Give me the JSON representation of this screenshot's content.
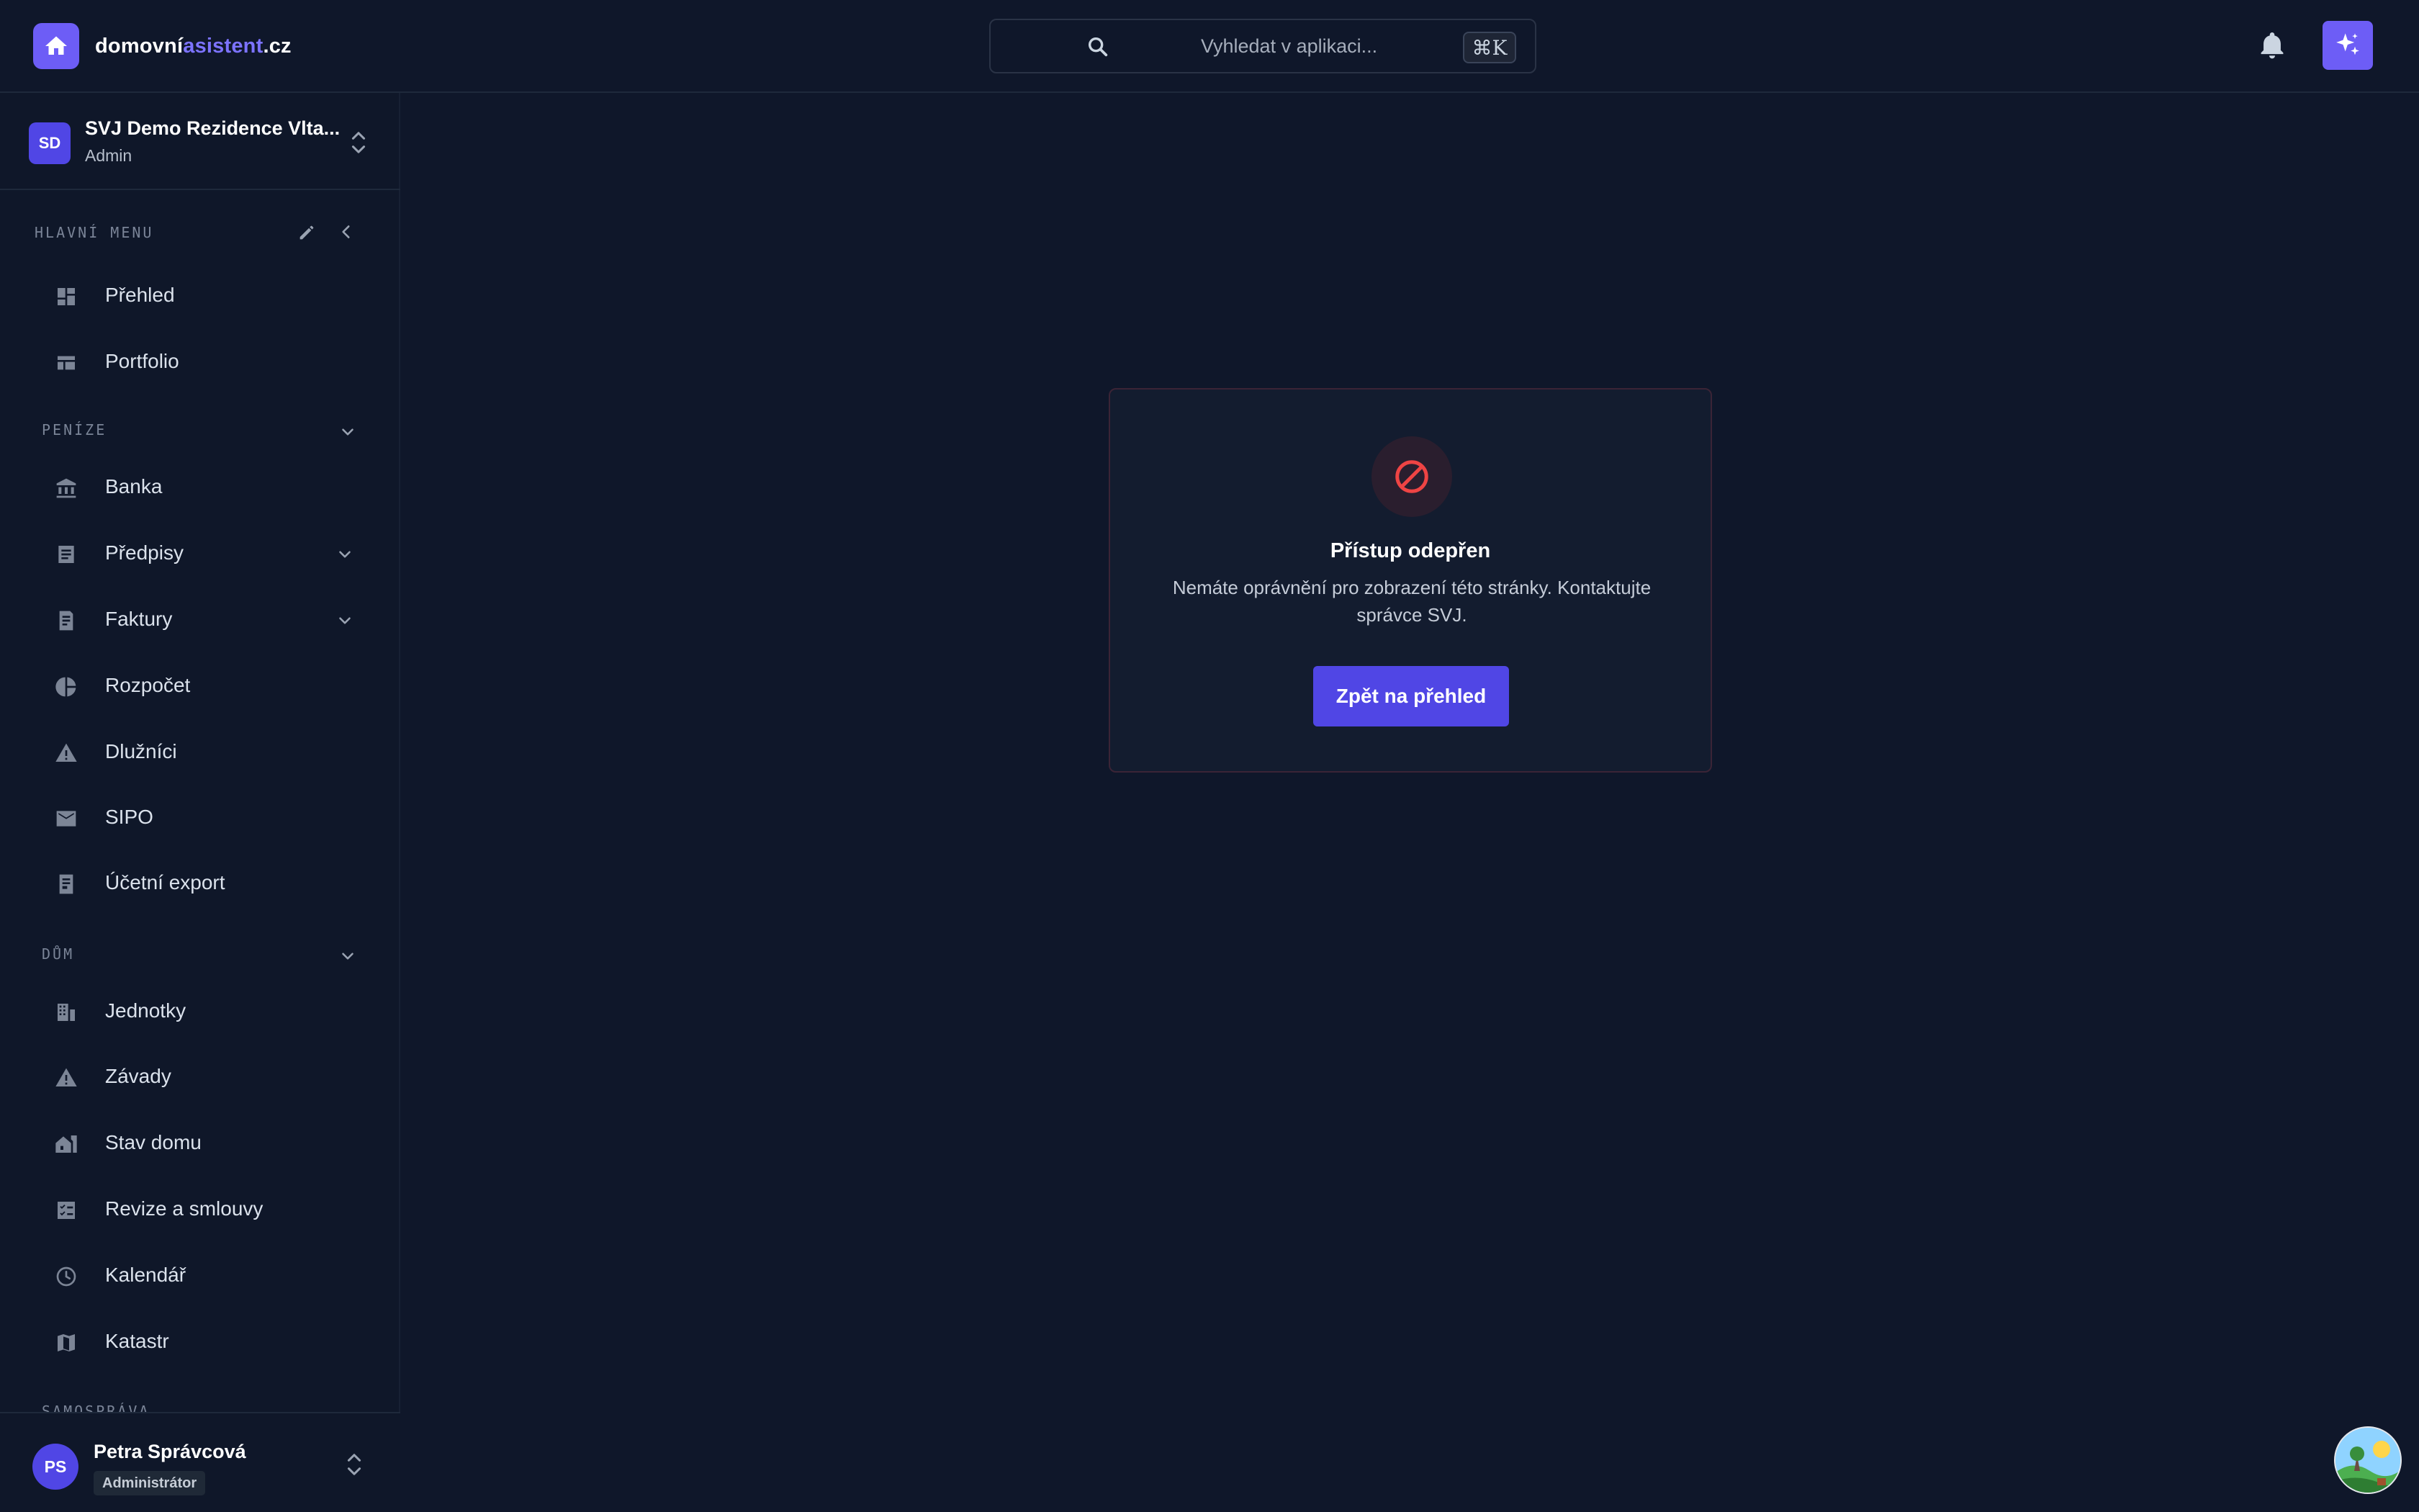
{
  "brand": {
    "name_part1": "domovní",
    "name_part2": "asistent",
    "name_part3": ".cz"
  },
  "search": {
    "placeholder": "Vyhledat v aplikaci...",
    "shortcut": "⌘K"
  },
  "org": {
    "initials": "SD",
    "name": "SVJ Demo Rezidence Vlta...",
    "role": "Admin"
  },
  "sidebar": {
    "main_heading": "HLAVNÍ MENU",
    "main_items": [
      {
        "label": "Přehled",
        "icon": "dashboard-icon"
      },
      {
        "label": "Portfolio",
        "icon": "portfolio-icon"
      }
    ],
    "money_heading": "PENÍZE",
    "money_items": [
      {
        "label": "Banka",
        "icon": "bank-icon"
      },
      {
        "label": "Předpisy",
        "icon": "document-list-icon"
      },
      {
        "label": "Faktury",
        "icon": "invoice-icon"
      },
      {
        "label": "Rozpočet",
        "icon": "pie-chart-icon"
      },
      {
        "label": "Dlužníci",
        "icon": "warning-icon"
      },
      {
        "label": "SIPO",
        "icon": "mail-icon"
      },
      {
        "label": "Účetní export",
        "icon": "receipt-icon"
      }
    ],
    "house_heading": "DŮM",
    "house_items": [
      {
        "label": "Jednotky",
        "icon": "apartment-icon"
      },
      {
        "label": "Závady",
        "icon": "warning-icon"
      },
      {
        "label": "Stav domu",
        "icon": "house-status-icon"
      },
      {
        "label": "Revize a smlouvy",
        "icon": "checklist-icon"
      },
      {
        "label": "Kalendář",
        "icon": "clock-icon"
      },
      {
        "label": "Katastr",
        "icon": "map-icon"
      }
    ],
    "next_heading": "SAMOSPRÁVA"
  },
  "user": {
    "initials": "PS",
    "name": "Petra Správcová",
    "role": "Administrátor"
  },
  "error_card": {
    "title": "Přístup odepřen",
    "message": "Nemáte oprávnění pro zobrazení této stránky. Kontaktujte správce SVJ.",
    "button": "Zpět na přehled"
  },
  "colors": {
    "accent": "#5046e5",
    "background": "#0f172a",
    "danger": "#ef4444"
  }
}
